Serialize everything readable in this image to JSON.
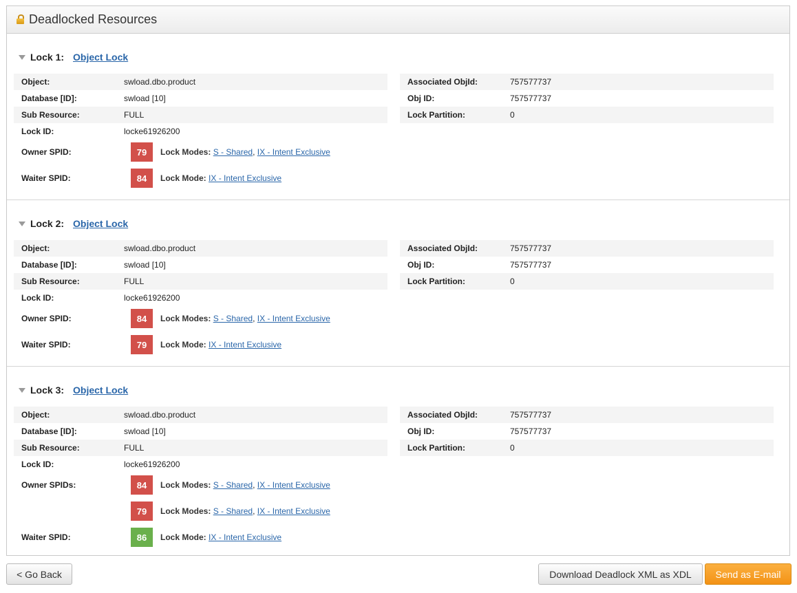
{
  "panel": {
    "title": "Deadlocked Resources",
    "icon": "lock-icon"
  },
  "labels": {
    "object": "Object:",
    "database": "Database [ID]:",
    "sub_resource": "Sub Resource:",
    "lock_id": "Lock ID:",
    "associated_objid": "Associated ObjId:",
    "obj_id": "Obj ID:",
    "lock_partition": "Lock Partition:",
    "lock_modes": "Lock Modes:",
    "lock_mode": "Lock Mode:"
  },
  "locks": [
    {
      "heading": "Lock 1:",
      "type": "Object Lock",
      "object": "swload.dbo.product",
      "database": "swload [10]",
      "sub_resource": "FULL",
      "lock_id": "locke61926200",
      "associated_objid": "757577737",
      "obj_id": "757577737",
      "lock_partition": "0",
      "owner_label": "Owner SPID:",
      "owners": [
        {
          "spid": "79",
          "modes": [
            "S - Shared",
            "IX - Intent Exclusive"
          ]
        }
      ],
      "waiter_label": "Waiter SPID:",
      "waiter": {
        "spid": "84",
        "mode": "IX - Intent Exclusive"
      }
    },
    {
      "heading": "Lock 2:",
      "type": "Object Lock",
      "object": "swload.dbo.product",
      "database": "swload [10]",
      "sub_resource": "FULL",
      "lock_id": "locke61926200",
      "associated_objid": "757577737",
      "obj_id": "757577737",
      "lock_partition": "0",
      "owner_label": "Owner SPID:",
      "owners": [
        {
          "spid": "84",
          "modes": [
            "S - Shared",
            "IX - Intent Exclusive"
          ]
        }
      ],
      "waiter_label": "Waiter SPID:",
      "waiter": {
        "spid": "79",
        "mode": "IX - Intent Exclusive"
      }
    },
    {
      "heading": "Lock 3:",
      "type": "Object Lock",
      "object": "swload.dbo.product",
      "database": "swload [10]",
      "sub_resource": "FULL",
      "lock_id": "locke61926200",
      "associated_objid": "757577737",
      "obj_id": "757577737",
      "lock_partition": "0",
      "owner_label": "Owner SPIDs:",
      "owners": [
        {
          "spid": "84",
          "modes": [
            "S - Shared",
            "IX - Intent Exclusive"
          ]
        },
        {
          "spid": "79",
          "modes": [
            "S - Shared",
            "IX - Intent Exclusive"
          ]
        }
      ],
      "waiter_label": "Waiter SPID:",
      "waiter": {
        "spid": "86",
        "mode": "IX - Intent Exclusive"
      }
    }
  ],
  "buttons": {
    "back": "< Go Back",
    "download": "Download Deadlock XML as XDL",
    "email": "Send as E-mail"
  },
  "colors": {
    "blocked_spid": "#d2504a",
    "free_spid": "#6ab04c",
    "link": "#2a66a9",
    "primary_button": "#f39216"
  }
}
